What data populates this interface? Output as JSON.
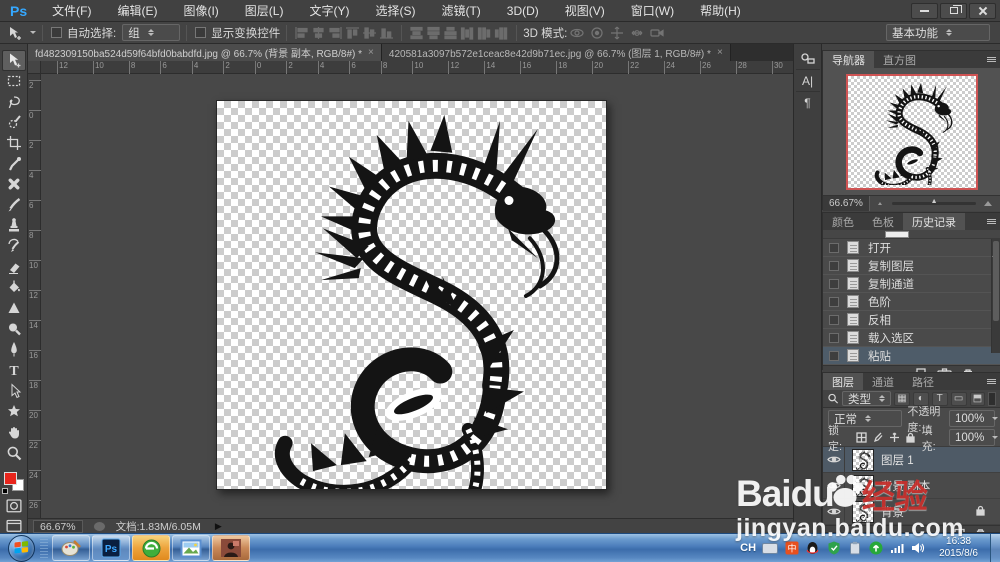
{
  "menu_bar": {
    "logo": "Ps",
    "items": [
      "文件(F)",
      "编辑(E)",
      "图像(I)",
      "图层(L)",
      "文字(Y)",
      "选择(S)",
      "滤镜(T)",
      "3D(D)",
      "视图(V)",
      "窗口(W)",
      "帮助(H)"
    ]
  },
  "options_bar": {
    "auto_select_label": "自动选择:",
    "auto_select_value": "组",
    "show_transform_label": "显示变换控件",
    "mode_3d_label": "3D 模式:",
    "workspace_switcher": "基本功能"
  },
  "doc_tabs": {
    "tab1": "fd482309150ba524d59f64bfd0babdfd.jpg @ 66.7% (背景 副本, RGB/8#) *",
    "tab2": "420581a3097b572e1ceac8e42d9b71ec.jpg @ 66.7% (图层 1, RGB/8#) *",
    "close_glyph": "×"
  },
  "rulers": {
    "top": [
      "12",
      "10",
      "8",
      "6",
      "4",
      "2",
      "0",
      "2",
      "4",
      "6",
      "8",
      "10",
      "12",
      "14",
      "16",
      "18",
      "20",
      "22",
      "24",
      "26",
      "28",
      "30"
    ],
    "left": [
      "2",
      "0",
      "2",
      "4",
      "6",
      "8",
      "10",
      "12",
      "14",
      "16",
      "18",
      "20",
      "22",
      "24",
      "26"
    ]
  },
  "toolbar_icons": [
    "move-tool-icon",
    "marquee-tool-icon",
    "lasso-tool-icon",
    "quick-select-tool-icon",
    "crop-tool-icon",
    "eyedropper-tool-icon",
    "healing-tool-icon",
    "brush-tool-icon",
    "stamp-tool-icon",
    "history-brush-tool-icon",
    "eraser-tool-icon",
    "bucket-tool-icon",
    "blur-tool-icon",
    "dodge-tool-icon",
    "pen-tool-icon",
    "type-tool-icon",
    "path-select-tool-icon",
    "shape-tool-icon",
    "hand-tool-icon",
    "zoom-tool-icon"
  ],
  "status_bar": {
    "zoom": "66.67%",
    "doc_label": "文档:1.83M/6.05M",
    "play_glyph": "▶"
  },
  "navigator": {
    "tab_navigator": "导航器",
    "tab_histogram": "直方图",
    "zoom": "66.67%",
    "slider_thumb": "▲"
  },
  "history": {
    "tab_color": "颜色",
    "tab_swatches": "色板",
    "tab_history": "历史记录",
    "items": [
      "打开",
      "复制图层",
      "复制通道",
      "色阶",
      "反相",
      "载入选区",
      "粘贴"
    ],
    "selected": "粘贴"
  },
  "layers": {
    "tab_layers": "图层",
    "tab_channels": "通道",
    "tab_paths": "路径",
    "filter_label": "类型",
    "type_icons": [
      "pixel-filter-icon",
      "adjustment-filter-icon",
      "type-filter-icon",
      "shape-filter-icon",
      "smart-filter-icon"
    ],
    "type_glyphs": [
      "▦",
      "◐",
      "T",
      "▭",
      "⬒"
    ],
    "blend_mode": "正常",
    "opacity_label": "不透明度:",
    "opacity_value": "100%",
    "lock_label": "锁定:",
    "fill_label": "填充:",
    "fill_value": "100%",
    "items": [
      {
        "name": "图层 1",
        "selected": true
      },
      {
        "name": "背景 副本",
        "selected": false
      },
      {
        "name": "背景",
        "selected": false,
        "locked": true
      }
    ]
  },
  "collapsed_panels": [
    "clone-source-panel-icon",
    "character-panel-icon",
    "paragraph-panel-icon"
  ],
  "collapsed_glyphs": {
    "character": "A|",
    "paragraph": "¶"
  },
  "watermark": {
    "brand": "Baidu",
    "badge": "经验",
    "url": "jingyan.baidu.com"
  },
  "taskbar": {
    "lang": "CH",
    "time": "16:38",
    "date": "2015/8/6"
  },
  "colors": {
    "ps_blue": "#35a8ff",
    "selection_blue": "#4e5c69",
    "navigator_border": "#cf5454",
    "foreground_red": "#e8251c",
    "watermark_red": "#c9302c",
    "taskbar_blue": "#4a7cba"
  }
}
